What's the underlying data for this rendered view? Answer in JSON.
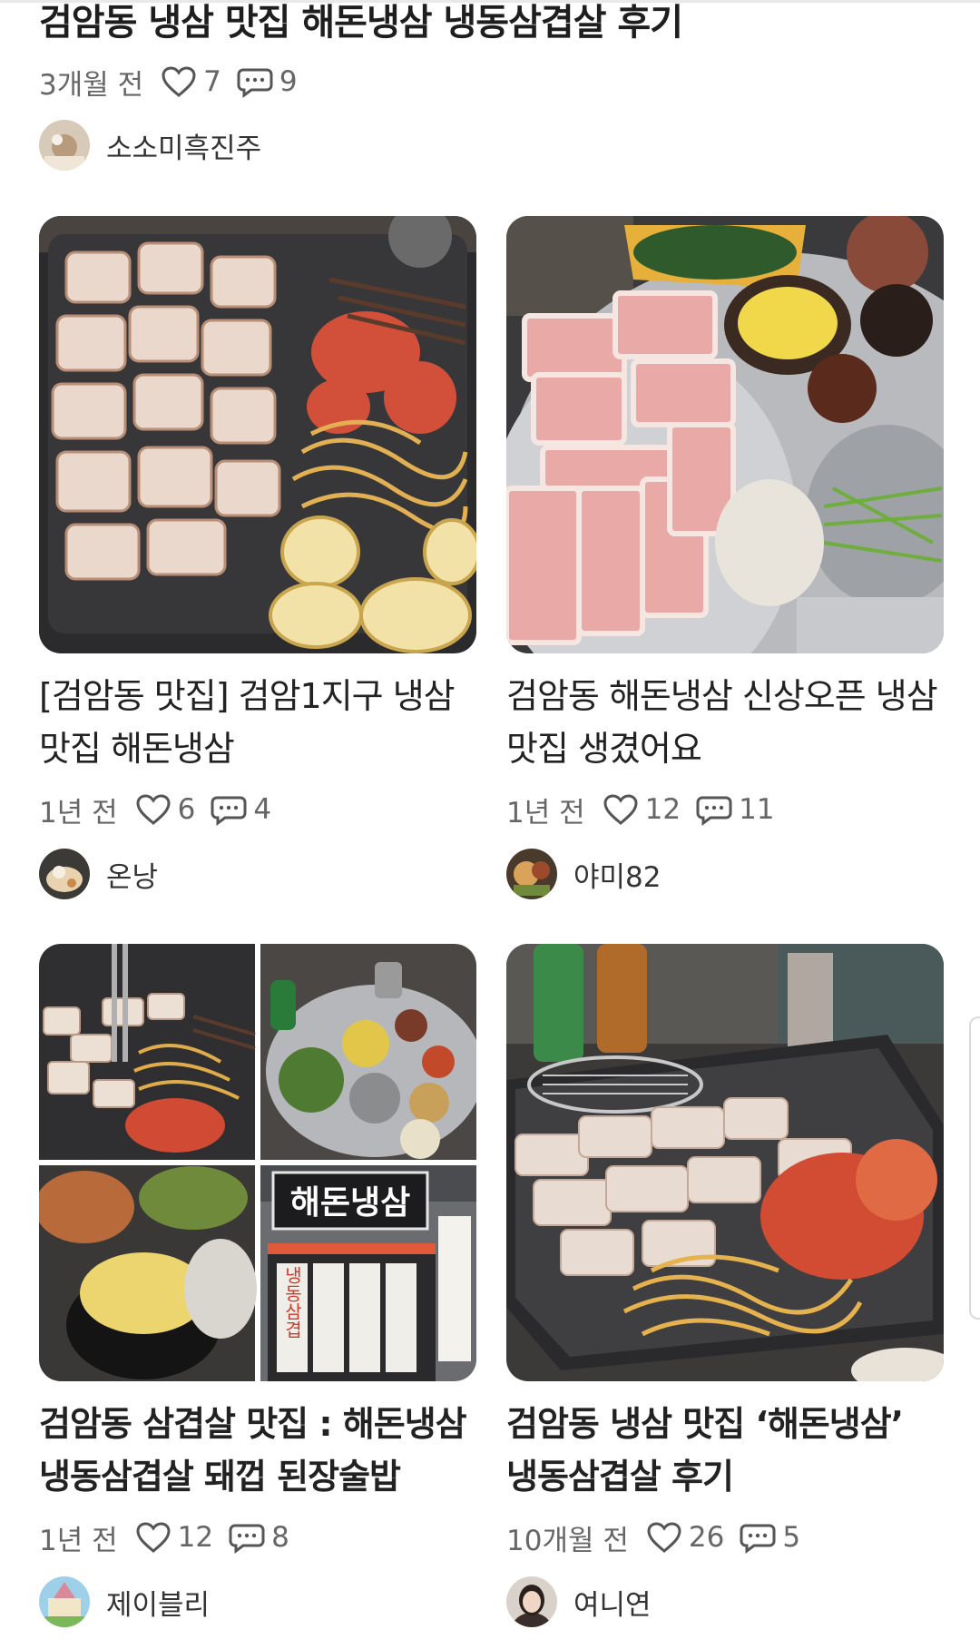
{
  "top_post": {
    "title": "검암동 냉삼 맛집 해돈냉삼 냉동삼겹살 후기",
    "time": "3개월 전",
    "likes": "7",
    "comments": "9",
    "author": "소소미흑진주"
  },
  "cards": [
    {
      "title": "[검암동 맛집] 검암1지구 냉삼맛집 해돈냉삼",
      "time": "1년 전",
      "likes": "6",
      "comments": "4",
      "author": "온낭"
    },
    {
      "title": "검암동 해돈냉삼 신상오픈 냉삼맛집 생겼어요",
      "time": "1년 전",
      "likes": "12",
      "comments": "11",
      "author": "야미82"
    },
    {
      "title": "검암동 삼겹살 맛집 : 해돈냉삼 냉동삼겹살 돼껍 된장술밥",
      "time": "1년 전",
      "likes": "12",
      "comments": "8",
      "author": "제이블리"
    },
    {
      "title": "검암동 냉삼 맛집 ‘해돈냉삼’ 냉동삼겹살 후기",
      "time": "10개월 전",
      "likes": "26",
      "comments": "5",
      "author": "여니연"
    }
  ],
  "photo_text": {
    "sign": "해돈냉삼",
    "vertical_sign": "냉동삼겹"
  },
  "icons": {
    "like": "heart-outline-icon",
    "comment": "speech-bubble-icon"
  },
  "colors": {
    "meta_text": "#666666",
    "title_text": "#222222"
  }
}
